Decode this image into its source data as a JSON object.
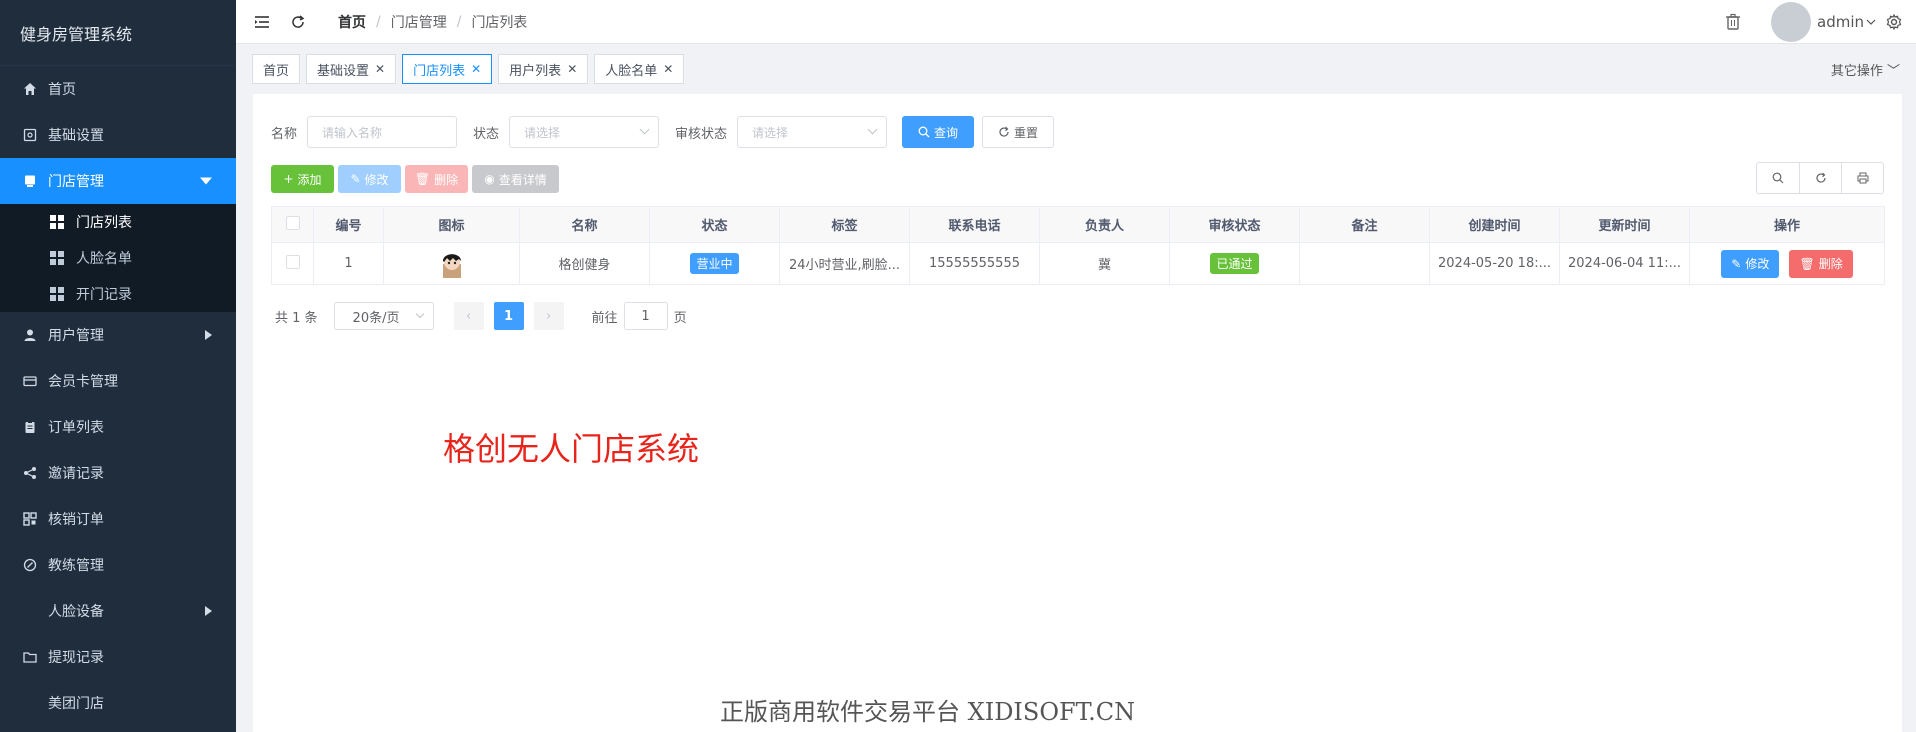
{
  "app": {
    "title": "健身房管理系统"
  },
  "sidebar": {
    "items": [
      {
        "label": "首页",
        "icon": "home-icon"
      },
      {
        "label": "基础设置",
        "icon": "settings-icon"
      },
      {
        "label": "门店管理",
        "icon": "store-icon",
        "expanded": true
      },
      {
        "label": "用户管理",
        "icon": "user-icon"
      },
      {
        "label": "会员卡管理",
        "icon": "card-icon"
      },
      {
        "label": "订单列表",
        "icon": "clipboard-icon"
      },
      {
        "label": "邀请记录",
        "icon": "share-icon"
      },
      {
        "label": "核销订单",
        "icon": "qr-icon"
      },
      {
        "label": "教练管理",
        "icon": "coach-icon"
      },
      {
        "label": "人脸设备",
        "icon": "grid-icon"
      },
      {
        "label": "提现记录",
        "icon": "folder-icon"
      },
      {
        "label": "美团门店",
        "icon": "grid-icon"
      }
    ],
    "submenu": [
      {
        "label": "门店列表",
        "active": true
      },
      {
        "label": "人脸名单"
      },
      {
        "label": "开门记录"
      }
    ]
  },
  "header": {
    "breadcrumb": [
      "首页",
      "门店管理",
      "门店列表"
    ],
    "user": "admin"
  },
  "tags": {
    "items": [
      {
        "label": "首页",
        "closable": false
      },
      {
        "label": "基础设置",
        "closable": true
      },
      {
        "label": "门店列表",
        "closable": true,
        "active": true
      },
      {
        "label": "用户列表",
        "closable": true
      },
      {
        "label": "人脸名单",
        "closable": true
      }
    ],
    "other_ops": "其它操作"
  },
  "filter": {
    "name_label": "名称",
    "name_placeholder": "请输入名称",
    "status_label": "状态",
    "status_placeholder": "请选择",
    "audit_label": "审核状态",
    "audit_placeholder": "请选择",
    "search_btn": "查询",
    "reset_btn": "重置"
  },
  "toolbar": {
    "add": "添加",
    "edit": "修改",
    "delete": "删除",
    "detail": "查看详情"
  },
  "table": {
    "headers": [
      "编号",
      "图标",
      "名称",
      "状态",
      "标签",
      "联系电话",
      "负责人",
      "审核状态",
      "备注",
      "创建时间",
      "更新时间",
      "操作"
    ],
    "rows": [
      {
        "id": "1",
        "name": "格创健身",
        "status": "营业中",
        "tags": "24小时营业,刷脸...",
        "phone": "15555555555",
        "manager": "冀",
        "audit": "已通过",
        "remark": "",
        "created": "2024-05-20 18:...",
        "updated": "2024-06-04 11:...",
        "edit": "修改",
        "delete": "删除"
      }
    ]
  },
  "pager": {
    "total": "共 1 条",
    "page_size": "20条/页",
    "current": "1",
    "goto_label": "前往",
    "goto_value": "1",
    "page_unit": "页"
  },
  "overlay": {
    "red_text": "格创无人门店系统",
    "gray_text": "正版商用软件交易平台 XIDISOFT.CN"
  },
  "colors": {
    "sidebar_bg": "#1f2d3d",
    "active": "#1890ff",
    "primary": "#409eff",
    "success": "#67c23a",
    "danger": "#f56c6c"
  }
}
